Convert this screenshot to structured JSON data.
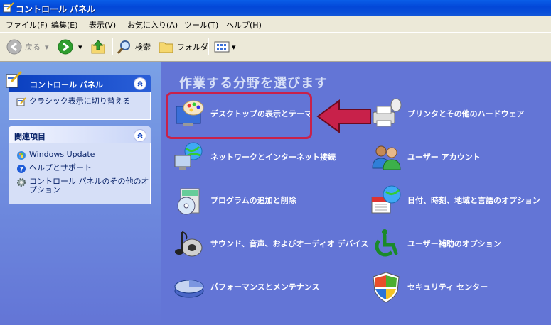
{
  "window": {
    "title": "コントロール パネル"
  },
  "menu": [
    "ファイル(F)",
    "編集(E)",
    "表示(V)",
    "お気に入り(A)",
    "ツール(T)",
    "ヘルプ(H)"
  ],
  "toolbar": {
    "back_label": "戻る",
    "search_label": "検索",
    "folders_label": "フォルダ"
  },
  "left": {
    "cp_panel": {
      "title": "コントロール パネル",
      "switch_link": "クラシック表示に切り替える"
    },
    "related": {
      "title": "関連項目",
      "links": [
        "Windows Update",
        "ヘルプとサポート",
        "コントロール パネルのその他のオプション"
      ]
    }
  },
  "main": {
    "heading": "作業する分野を選びます",
    "categories": [
      {
        "label": "デスクトップの表示とテーマ",
        "icon": "display-theme-icon"
      },
      {
        "label": "プリンタとその他のハードウェア",
        "icon": "printer-hardware-icon"
      },
      {
        "label": "ネットワークとインターネット接続",
        "icon": "network-icon"
      },
      {
        "label": "ユーザー アカウント",
        "icon": "user-accounts-icon"
      },
      {
        "label": "プログラムの追加と削除",
        "icon": "add-remove-programs-icon"
      },
      {
        "label": "日付、時刻、地域と言語のオプション",
        "icon": "date-time-region-icon"
      },
      {
        "label": "サウンド、音声、およびオーディオ デバイス",
        "icon": "sound-icon"
      },
      {
        "label": "ユーザー補助のオプション",
        "icon": "accessibility-icon"
      },
      {
        "label": "パフォーマンスとメンテナンス",
        "icon": "performance-icon"
      },
      {
        "label": "セキュリティ センター",
        "icon": "security-center-icon"
      }
    ]
  },
  "colors": {
    "titlebar": "#0a4fd8",
    "main_bg": "#6375d6",
    "highlight": "#c8214a"
  }
}
